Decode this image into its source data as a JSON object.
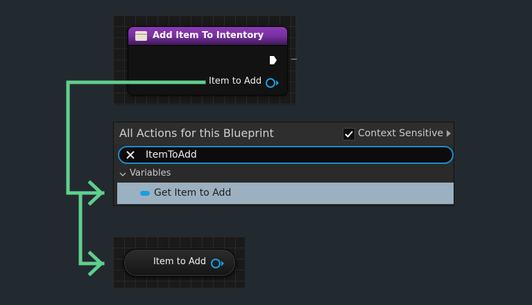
{
  "node": {
    "title": "Add Item To Intentory",
    "output_pin_label": "Item to Add"
  },
  "menu": {
    "title": "All Actions for this Blueprint",
    "context_sensitive_label": "Context Sensitive",
    "context_sensitive_checked": true,
    "search_value": "ItemToAdd",
    "category": "Variables",
    "items": [
      {
        "label": "Get Item to Add",
        "selected": true
      }
    ]
  },
  "getter_node": {
    "pin_label": "Item to Add"
  },
  "colors": {
    "annotation_green": "#5fcf8e",
    "pin_blue": "#1a9fe0",
    "function_header_purple": "#7a2fa3",
    "selection_bg": "#9bb0c0"
  }
}
